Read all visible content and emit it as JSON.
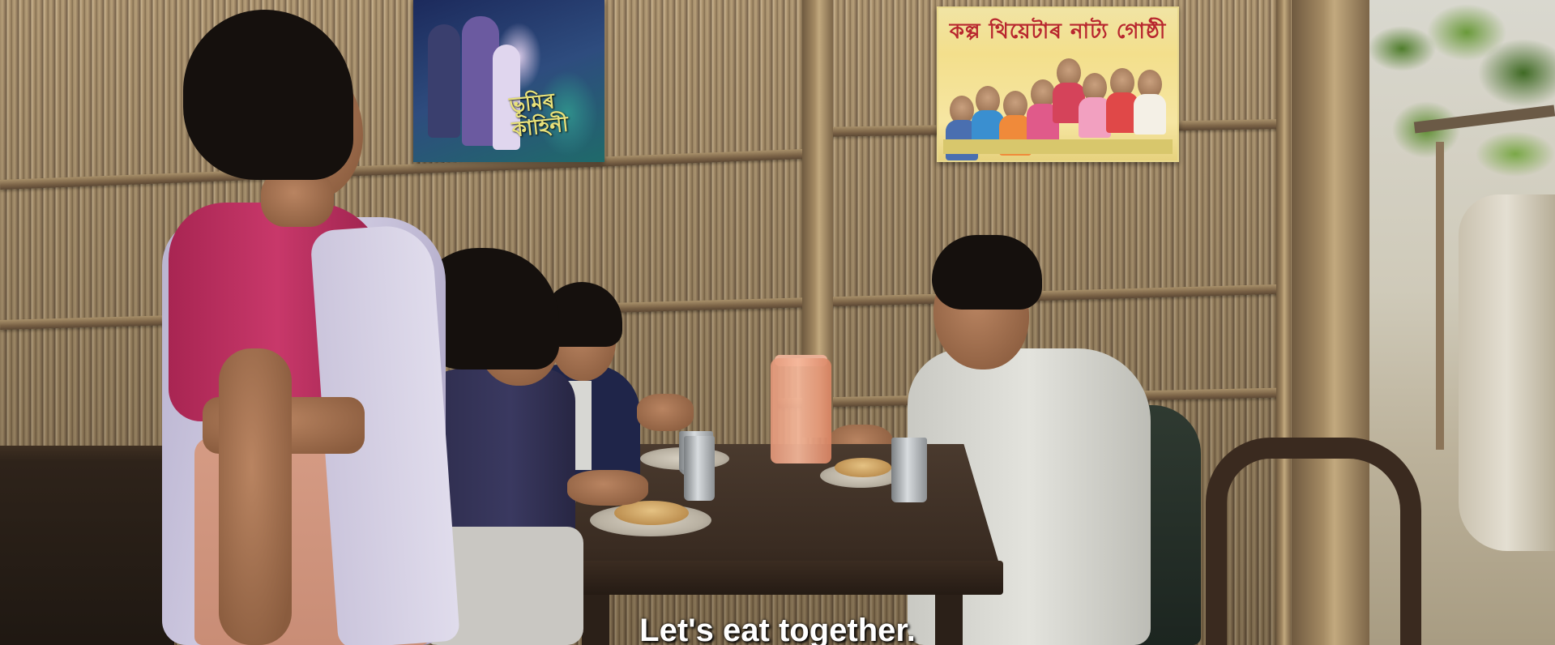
{
  "scene": {
    "subtitle": "Let's eat together."
  },
  "colors": {
    "bamboo_wall": "#9c8460",
    "woman_blouse": "#c2325f",
    "woman_saree": "#c9c4dc",
    "boy_shirt": "#d8d8d2",
    "girls_uniform": "#2a2a4a",
    "jug": "#f1a98a",
    "poster_troupe_bg": "#f3df8c",
    "poster_movie_bg": "#1f3a6a",
    "subtitle_text": "#ffffff"
  }
}
